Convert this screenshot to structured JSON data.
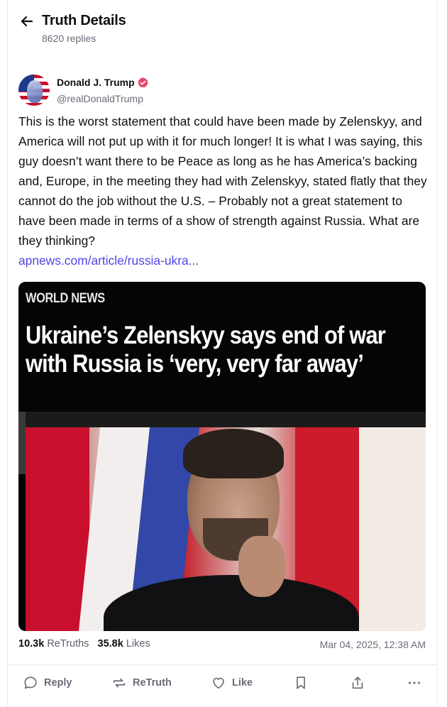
{
  "header": {
    "title": "Truth Details",
    "reply_count": "8620 replies"
  },
  "post": {
    "author": {
      "name": "Donald J. Trump",
      "handle": "@realDonaldTrump",
      "verified": true
    },
    "text": "This is the worst statement that could have been made by Zelenskyy, and America will not put up with it for much longer! It is what I was saying, this guy doesn’t want there to be Peace as long as he has America’s backing and, Europe, in the meeting they had with Zelenskyy, stated flatly that they cannot do the job without the U.S. – Probably not a great statement to have been made in terms of a show of strength against Russia. What are they thinking?",
    "link": "apnews.com/article/russia-ukra...",
    "media": {
      "kicker": "WORLD NEWS",
      "headline": "Ukraine’s Zelenskyy says end of war with Russia is ‘very, very far away’"
    },
    "stats": {
      "retruths_count": "10.3k",
      "retruths_label": "ReTruths",
      "likes_count": "35.8k",
      "likes_label": "Likes"
    },
    "timestamp": "Mar 04, 2025, 12:38 AM"
  },
  "actions": {
    "reply": "Reply",
    "retruth": "ReTruth",
    "like": "Like"
  },
  "colors": {
    "link": "#4f46e5",
    "verified_badge": "#e8466e",
    "muted_text": "#6b6b78"
  },
  "icons": [
    "arrow-left-icon",
    "verified-badge-icon",
    "reply-icon",
    "retruth-icon",
    "heart-icon",
    "bookmark-icon",
    "share-icon",
    "more-icon"
  ]
}
